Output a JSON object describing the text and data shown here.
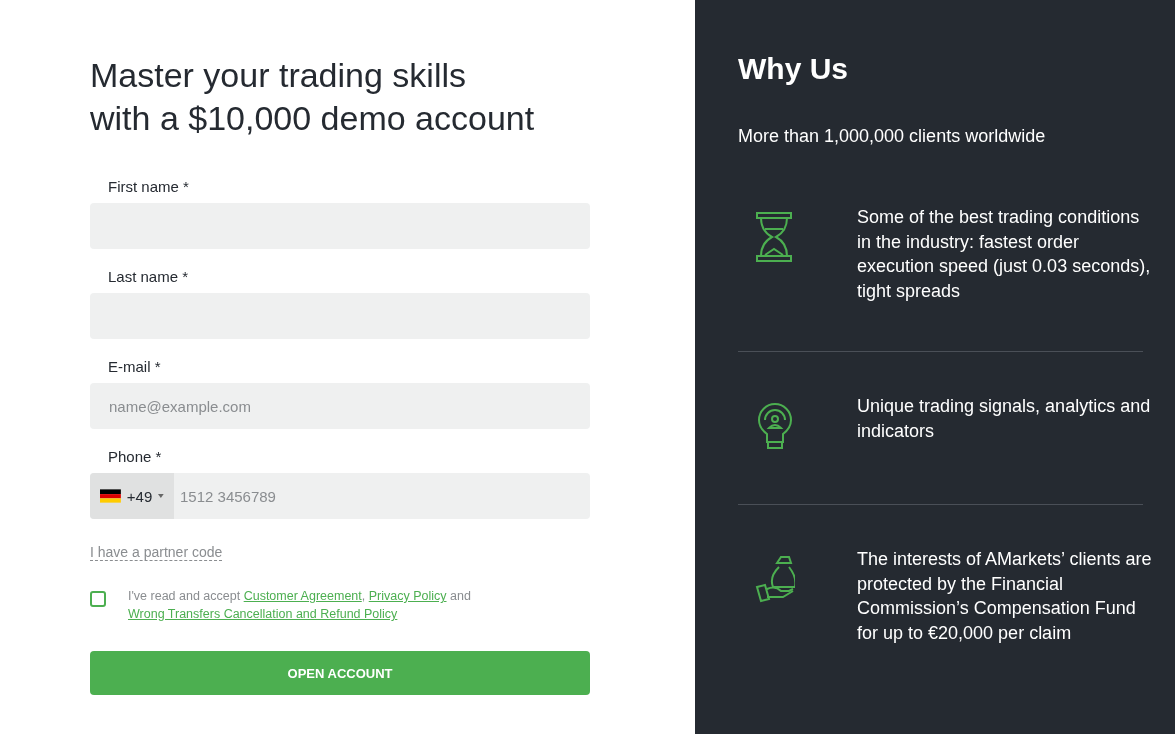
{
  "form": {
    "title_lines": [
      "Master your trading skills",
      "with a $10,000 demo account"
    ],
    "fields": [
      {
        "kind": "text",
        "label": "First name *"
      },
      {
        "kind": "text",
        "label": "Last name *"
      },
      {
        "kind": "text",
        "label": "E-mail *",
        "placeholder": "name@example.com"
      },
      {
        "kind": "phone",
        "label": "Phone *",
        "code": "+49",
        "placeholder": "1512 3456789"
      }
    ],
    "partner_link": "I have a partner code",
    "terms": {
      "checked": false,
      "parts": [
        {
          "kind": "text",
          "text": "I've read and accept "
        },
        {
          "kind": "link",
          "text": "Customer Agreement"
        },
        {
          "kind": "text",
          "text": ", "
        },
        {
          "kind": "link",
          "text": "Privacy Policy"
        },
        {
          "kind": "text",
          "text": " and "
        },
        {
          "kind": "link",
          "text": "Wrong Transfers Cancellation and Refund Policy"
        }
      ]
    },
    "submit": "OPEN ACCOUNT"
  },
  "why": {
    "title": "Why Us",
    "subtitle": "More than 1,000,000 clients worldwide",
    "features": [
      {
        "kind": "hourglass",
        "text": "Some of the best trading conditions in the industry: fastest order execution speed (just 0.03 seconds), tight spreads"
      },
      {
        "kind": "bulb",
        "text": "Unique trading signals, analytics and indicators"
      },
      {
        "kind": "money",
        "text": "The interests of AMarkets’ clients are protected by the Financial Commission’s Compensation Fund for up to €20,000 per claim"
      }
    ]
  }
}
